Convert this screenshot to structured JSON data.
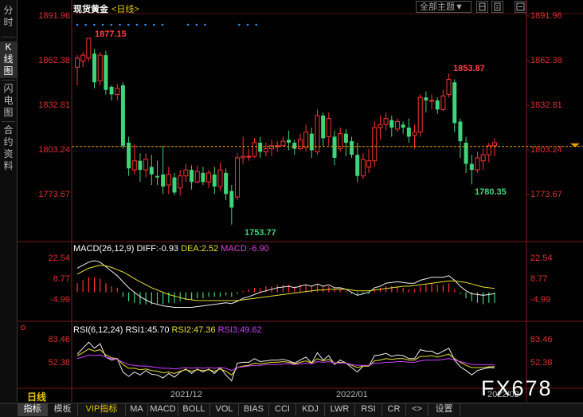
{
  "left_tabs": [
    {
      "label": "分\n时",
      "active": false
    },
    {
      "label": "K\n线\n图",
      "active": true
    },
    {
      "label": "闪\n电\n图",
      "active": false
    },
    {
      "label": "合\n约\n资\n料",
      "active": false
    }
  ],
  "header": {
    "title": "现货黄金",
    "period": "<日线>",
    "theme_button": "全部主题▼",
    "tool_icons": [
      "layout-icon",
      "settings-icon",
      "collapse-icon"
    ]
  },
  "main_axis": {
    "ticks": [
      "1891.96",
      "1862.38",
      "1832.81",
      "1803.24",
      "1773.67"
    ],
    "tick_values": [
      1891.96,
      1862.38,
      1832.81,
      1803.24,
      1773.67
    ]
  },
  "annotations": {
    "high": "1877.15",
    "low": "1753.77",
    "recent_high": "1853.87",
    "recent_low": "1780.35"
  },
  "current_price": 1805.5,
  "macd": {
    "legend_name": "MACD(26,12,9)",
    "diff": "DIFF:-0.93",
    "dea": "DEA:2.52",
    "macd": "MACD:-6.90",
    "ticks": [
      "22.54",
      "8.77",
      "-4.99"
    ],
    "tick_values": [
      22.54,
      8.77,
      -4.99
    ]
  },
  "rsi": {
    "legend_name": "RSI(6,12,24)",
    "rsi1": "RSI1:45.70",
    "rsi2": "RSI2:47.36",
    "rsi3": "RSI3:49.62",
    "ticks": [
      "83.46",
      "52.38"
    ],
    "tick_values": [
      83.46,
      52.38
    ]
  },
  "x_axis": {
    "period_label": "日线",
    "dates": [
      "2021/12",
      "2022/01",
      "2022/02"
    ]
  },
  "bottom_tabs": [
    "指标",
    "模板",
    "VIP指标",
    "MA",
    "MACD",
    "BOLL",
    "VOL",
    "BIAS",
    "CCI",
    "KDJ",
    "LWR",
    "RSI",
    "CR",
    "<>",
    "设置"
  ],
  "watermark": "FX678",
  "colors": {
    "up": "#ff3232",
    "down": "#3fd47a",
    "axis_label": "#e03030",
    "accent": "#e8c800",
    "macd_dea": "#e8e030",
    "macd_macd": "#e040e0",
    "rsi2": "#e8e030",
    "rsi3": "#d040ff"
  },
  "chart_data": {
    "type": "candlestick",
    "title": "现货黄金",
    "ylim": [
      1748,
      1892
    ],
    "candles": [
      [
        1858,
        1864,
        1846,
        1866
      ],
      [
        1862,
        1866,
        1858,
        1868
      ],
      [
        1864,
        1877.15,
        1862,
        1877.15
      ],
      [
        1867,
        1848,
        1844,
        1870
      ],
      [
        1849,
        1866,
        1846,
        1868
      ],
      [
        1866,
        1843,
        1840,
        1869
      ],
      [
        1845,
        1840,
        1836,
        1846
      ],
      [
        1840,
        1844,
        1836,
        1847
      ],
      [
        1846,
        1806,
        1804,
        1848
      ],
      [
        1808,
        1791,
        1786,
        1812
      ],
      [
        1790,
        1796,
        1787,
        1807
      ],
      [
        1796,
        1790,
        1782,
        1801
      ],
      [
        1790,
        1797,
        1785,
        1801
      ],
      [
        1792,
        1787,
        1780,
        1800
      ],
      [
        1786,
        1785,
        1780,
        1796
      ],
      [
        1787,
        1779,
        1774,
        1806
      ],
      [
        1780,
        1787,
        1774,
        1792
      ],
      [
        1785,
        1775,
        1773,
        1788
      ],
      [
        1778,
        1786,
        1773,
        1790
      ],
      [
        1786,
        1790,
        1782,
        1794
      ],
      [
        1790,
        1782,
        1777,
        1793
      ],
      [
        1782,
        1789,
        1781,
        1793
      ],
      [
        1788,
        1782,
        1780,
        1792
      ],
      [
        1782,
        1788,
        1778,
        1790
      ],
      [
        1787,
        1779,
        1774,
        1792
      ],
      [
        1779,
        1790,
        1776,
        1795
      ],
      [
        1788,
        1774,
        1770,
        1791
      ],
      [
        1776,
        1765,
        1753.77,
        1780
      ],
      [
        1772,
        1798,
        1770,
        1801
      ],
      [
        1798,
        1799,
        1794,
        1812
      ],
      [
        1799,
        1799,
        1796,
        1804
      ],
      [
        1799,
        1808,
        1798,
        1811
      ],
      [
        1808,
        1802,
        1798,
        1812
      ],
      [
        1802,
        1804,
        1799,
        1808
      ],
      [
        1804,
        1806,
        1799,
        1810
      ],
      [
        1806,
        1806,
        1802,
        1809
      ],
      [
        1806,
        1809,
        1806,
        1812
      ],
      [
        1810,
        1808,
        1803,
        1816
      ],
      [
        1808,
        1804,
        1800,
        1810
      ],
      [
        1804,
        1810,
        1803,
        1814
      ],
      [
        1805,
        1815,
        1802,
        1820
      ],
      [
        1814,
        1803,
        1798,
        1818
      ],
      [
        1802,
        1826,
        1800,
        1830
      ],
      [
        1826,
        1811,
        1806,
        1828
      ],
      [
        1812,
        1824,
        1806,
        1828
      ],
      [
        1812,
        1798,
        1793,
        1816
      ],
      [
        1804,
        1814,
        1802,
        1818
      ],
      [
        1814,
        1808,
        1799,
        1817
      ],
      [
        1809,
        1800,
        1798,
        1812
      ],
      [
        1800,
        1786,
        1782,
        1808
      ],
      [
        1786,
        1797,
        1784,
        1801
      ],
      [
        1792,
        1796,
        1788,
        1804
      ],
      [
        1796,
        1818,
        1792,
        1822
      ],
      [
        1818,
        1820,
        1810,
        1826
      ],
      [
        1820,
        1824,
        1816,
        1828
      ],
      [
        1823,
        1818,
        1812,
        1826
      ],
      [
        1817,
        1822,
        1815,
        1824
      ],
      [
        1820,
        1818,
        1814,
        1822
      ],
      [
        1818,
        1812,
        1808,
        1824
      ],
      [
        1813,
        1815,
        1804,
        1820
      ],
      [
        1815,
        1838,
        1812,
        1840
      ],
      [
        1838,
        1836,
        1828,
        1842
      ],
      [
        1836,
        1836,
        1830,
        1840
      ],
      [
        1836,
        1830,
        1827,
        1838
      ],
      [
        1830,
        1839,
        1829,
        1843
      ],
      [
        1840,
        1850,
        1838,
        1853.87
      ],
      [
        1848,
        1821,
        1815,
        1850
      ],
      [
        1822,
        1809,
        1798,
        1824
      ],
      [
        1808,
        1794,
        1788,
        1812
      ],
      [
        1794,
        1790,
        1780.35,
        1800
      ],
      [
        1790,
        1798,
        1788,
        1802
      ],
      [
        1796,
        1800,
        1790,
        1804
      ],
      [
        1800,
        1806,
        1795,
        1808
      ],
      [
        1806,
        1808,
        1799,
        1811
      ]
    ],
    "macd": {
      "hist": [
        6,
        8,
        10,
        10,
        9,
        6,
        4,
        3,
        -3,
        -6,
        -7,
        -8,
        -8,
        -8,
        -8,
        -8,
        -7,
        -7,
        -6,
        -5,
        -5,
        -4,
        -4,
        -3,
        -3,
        -3,
        -2,
        -3,
        -1,
        1,
        2,
        3,
        3,
        4,
        4,
        5,
        5,
        5,
        4,
        5,
        5,
        4,
        5,
        4,
        4,
        2,
        2,
        1,
        -1,
        -2,
        -1,
        -1,
        2,
        3,
        4,
        4,
        4,
        3,
        2,
        2,
        4,
        5,
        6,
        5,
        5,
        6,
        2,
        -1,
        -4,
        -6,
        -7,
        -8,
        -7,
        -6.9
      ],
      "diff": [
        16,
        18,
        20,
        21,
        20,
        17,
        14,
        11,
        7,
        3,
        0,
        -3,
        -5,
        -7,
        -8,
        -9,
        -9.5,
        -10,
        -10,
        -10,
        -10,
        -9.5,
        -9,
        -8.5,
        -8,
        -7.5,
        -7,
        -7.5,
        -6,
        -4,
        -3,
        -1.5,
        0,
        1,
        2,
        3,
        3.5,
        4,
        3,
        4,
        5,
        4,
        5.5,
        4,
        5,
        3,
        3,
        2,
        0,
        -2,
        -1,
        0,
        3,
        4,
        6,
        6.5,
        7,
        6.5,
        6,
        6,
        8,
        9,
        10,
        10,
        10,
        11,
        8,
        4,
        1,
        -1,
        -1.5,
        -2,
        -1.5,
        -0.93
      ],
      "dea": [
        12,
        14,
        16,
        17,
        18,
        17.5,
        16.5,
        15,
        13.5,
        11.5,
        9,
        7,
        5,
        3,
        1.5,
        0,
        -1.5,
        -2.5,
        -3.5,
        -4.5,
        -5,
        -5.5,
        -5.5,
        -5.5,
        -5.5,
        -5.5,
        -5.5,
        -5.5,
        -5.5,
        -5,
        -4.5,
        -4,
        -3.5,
        -3,
        -2.5,
        -2,
        -1.5,
        -1,
        -0.5,
        0,
        0.5,
        1,
        1.5,
        1.5,
        2,
        2,
        2,
        2,
        1.5,
        1,
        1,
        1,
        1.5,
        2,
        2.5,
        3,
        3.5,
        4,
        4,
        4.5,
        5,
        5.5,
        6,
        6.5,
        7,
        7.5,
        7.5,
        7,
        6.5,
        5.5,
        4.5,
        3.5,
        3,
        2.52
      ]
    },
    "rsi": {
      "rsi1": [
        64,
        72,
        80,
        72,
        78,
        60,
        56,
        58,
        40,
        34,
        40,
        36,
        42,
        37,
        36,
        32,
        38,
        33,
        40,
        44,
        38,
        44,
        40,
        44,
        38,
        46,
        36,
        28,
        52,
        53,
        53,
        58,
        54,
        55,
        56,
        56,
        57,
        55,
        52,
        56,
        60,
        52,
        66,
        56,
        62,
        50,
        56,
        52,
        46,
        40,
        48,
        48,
        62,
        63,
        65,
        61,
        63,
        62,
        58,
        58,
        70,
        68,
        68,
        64,
        68,
        72,
        56,
        47,
        42,
        36,
        42,
        44,
        46,
        45.7
      ],
      "rsi2": [
        62,
        66,
        71,
        68,
        70,
        63,
        59,
        58,
        50,
        45,
        45,
        43,
        44,
        42,
        41,
        39,
        40,
        38,
        41,
        43,
        41,
        43,
        42,
        43,
        41,
        44,
        41,
        36,
        46,
        48,
        49,
        52,
        51,
        52,
        53,
        53,
        54,
        53,
        51,
        53,
        55,
        52,
        58,
        55,
        57,
        52,
        53,
        52,
        49,
        46,
        48,
        48,
        55,
        56,
        58,
        57,
        58,
        58,
        56,
        56,
        61,
        61,
        62,
        60,
        62,
        64,
        58,
        53,
        49,
        46,
        46,
        46,
        47,
        47.36
      ],
      "rsi3": [
        58,
        60,
        63,
        62,
        63,
        60,
        58,
        57,
        53,
        50,
        49,
        48,
        48,
        47,
        46,
        45,
        45,
        44,
        45,
        46,
        45,
        46,
        45,
        46,
        45,
        46,
        45,
        42,
        46,
        47,
        48,
        49,
        49,
        50,
        50,
        50,
        51,
        51,
        50,
        51,
        52,
        51,
        54,
        53,
        54,
        52,
        52,
        52,
        50,
        49,
        49,
        49,
        52,
        52,
        53,
        53,
        54,
        54,
        53,
        53,
        55,
        56,
        56,
        56,
        57,
        58,
        56,
        54,
        52,
        50,
        50,
        50,
        50,
        49.62
      ]
    }
  }
}
